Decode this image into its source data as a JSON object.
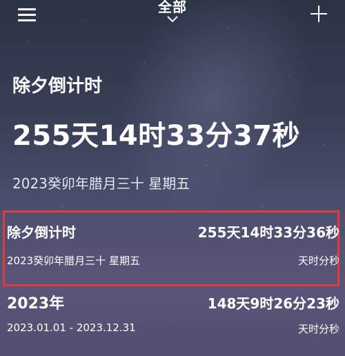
{
  "header": {
    "filter_label": "全部"
  },
  "hero": {
    "title": "除夕倒计时",
    "countdown": "255天14时33分37秒",
    "date": "2023癸卯年腊月三十 星期五"
  },
  "list": [
    {
      "name": "除夕倒计时",
      "countdown": "255天14时33分36秒",
      "date": "2023癸卯年腊月三十 星期五",
      "unit": "天时分秒",
      "highlighted": true
    },
    {
      "name": "2023年",
      "countdown": "148天9时26分23秒",
      "date": "2023.01.01 - 2023.12.31",
      "unit": "天时分秒"
    }
  ],
  "colors": {
    "highlight_border": "#e03a3a",
    "background_top": "#2b3346",
    "background_bottom": "#534f70"
  },
  "icons": [
    "menu-icon",
    "chevron-down-icon",
    "plus-icon"
  ]
}
